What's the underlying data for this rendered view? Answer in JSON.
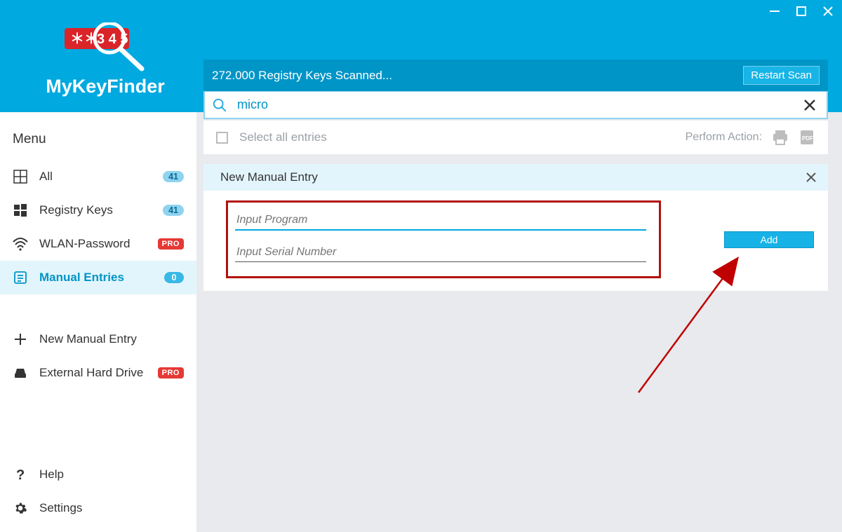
{
  "app": {
    "title": "MyKeyFinder",
    "logo_digits": "3 4 5",
    "logo_stars": "* *"
  },
  "window": {
    "minimize": "—",
    "maximize": "▢",
    "close": "✕"
  },
  "status": {
    "text": "272.000 Registry Keys Scanned...",
    "restart_label": "Restart Scan"
  },
  "search": {
    "value": "micro",
    "placeholder": ""
  },
  "sidebar": {
    "title": "Menu",
    "items": [
      {
        "id": "all",
        "label": "All",
        "count": "41",
        "badge": null,
        "icon": "grid"
      },
      {
        "id": "registry",
        "label": "Registry Keys",
        "count": "41",
        "badge": null,
        "icon": "windows"
      },
      {
        "id": "wlan",
        "label": "WLAN-Password",
        "count": null,
        "badge": "PRO",
        "icon": "wifi"
      },
      {
        "id": "manual",
        "label": "Manual Entries",
        "count": "0",
        "badge": null,
        "icon": "entries",
        "active": true
      }
    ],
    "secondary": [
      {
        "id": "new-manual",
        "label": "New Manual Entry",
        "icon": "plus"
      },
      {
        "id": "ext-drive",
        "label": "External Hard Drive",
        "icon": "drive",
        "badge": "PRO"
      }
    ],
    "footer": [
      {
        "id": "help",
        "label": "Help",
        "icon": "help"
      },
      {
        "id": "settings",
        "label": "Settings",
        "icon": "gear"
      }
    ]
  },
  "toolbar": {
    "select_all_label": "Select all entries",
    "perform_label": "Perform Action:"
  },
  "panel": {
    "title": "New Manual Entry",
    "program_placeholder": "Input Program",
    "serial_placeholder": "Input Serial Number",
    "add_label": "Add"
  }
}
